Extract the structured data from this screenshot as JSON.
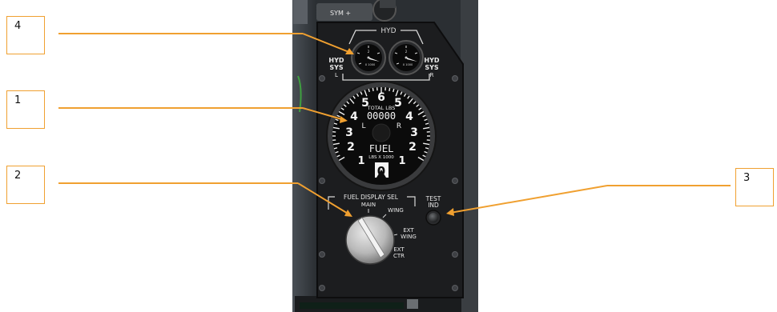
{
  "callouts": [
    {
      "number": "4"
    },
    {
      "number": "1"
    },
    {
      "number": "2"
    },
    {
      "number": "3"
    }
  ],
  "top_strip": {
    "sym_label": "SYM +"
  },
  "hyd": {
    "title": "HYD",
    "left_label_1": "HYD",
    "left_label_2": "SYS",
    "left_label_3": "L",
    "right_label_1": "HYD",
    "right_label_2": "SYS",
    "right_label_3": "R",
    "gauge_scale": "X 1000",
    "gauge_mark": "2"
  },
  "fuel_gauge": {
    "scale_numbers": [
      "6",
      "5",
      "5",
      "4",
      "4",
      "3",
      "3",
      "2",
      "2",
      "1",
      "1"
    ],
    "total_label": "TOTAL LBS",
    "total_value": "00000",
    "left_label": "L",
    "right_label": "R",
    "title": "FUEL",
    "subtitle": "LBS X 1000",
    "zero_label": "0"
  },
  "selector": {
    "title": "FUEL DISPLAY SEL",
    "pos_main": "MAIN",
    "pos_wing": "WING",
    "pos_ext_wing_1": "EXT",
    "pos_ext_wing_2": "WING",
    "pos_ext_ctr_1": "EXT",
    "pos_ext_ctr_2": "CTR"
  },
  "test_button": {
    "line1": "TEST",
    "line2": "IND"
  },
  "colors": {
    "callout": "#f0a030",
    "panel": "#1c1d1f",
    "bezel": "#3a3b3d"
  }
}
